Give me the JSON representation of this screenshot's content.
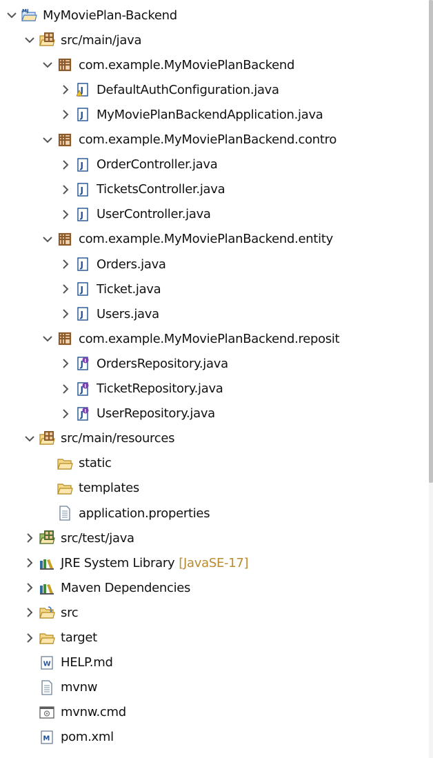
{
  "explorer": {
    "items": [
      {
        "label": "MyMoviePlan-Backend",
        "depth": 0,
        "state": "expanded",
        "icon": "maven-project-icon"
      },
      {
        "label": "src/main/java",
        "depth": 1,
        "state": "expanded",
        "icon": "source-folder-icon"
      },
      {
        "label": "com.example.MyMoviePlanBackend",
        "depth": 2,
        "state": "expanded",
        "icon": "package-icon"
      },
      {
        "label": "DefaultAuthConfiguration.java",
        "depth": 3,
        "state": "collapsed",
        "icon": "java-file-warning-icon"
      },
      {
        "label": "MyMoviePlanBackendApplication.java",
        "depth": 3,
        "state": "collapsed",
        "icon": "java-file-icon"
      },
      {
        "label": "com.example.MyMoviePlanBackend.contro",
        "depth": 2,
        "state": "expanded",
        "icon": "package-icon"
      },
      {
        "label": "OrderController.java",
        "depth": 3,
        "state": "collapsed",
        "icon": "java-file-icon"
      },
      {
        "label": "TicketsController.java",
        "depth": 3,
        "state": "collapsed",
        "icon": "java-file-icon"
      },
      {
        "label": "UserController.java",
        "depth": 3,
        "state": "collapsed",
        "icon": "java-file-icon"
      },
      {
        "label": "com.example.MyMoviePlanBackend.entity",
        "depth": 2,
        "state": "expanded",
        "icon": "package-icon"
      },
      {
        "label": "Orders.java",
        "depth": 3,
        "state": "collapsed",
        "icon": "java-file-icon"
      },
      {
        "label": "Ticket.java",
        "depth": 3,
        "state": "collapsed",
        "icon": "java-file-icon"
      },
      {
        "label": "Users.java",
        "depth": 3,
        "state": "collapsed",
        "icon": "java-file-icon"
      },
      {
        "label": "com.example.MyMoviePlanBackend.reposit",
        "depth": 2,
        "state": "expanded",
        "icon": "package-icon"
      },
      {
        "label": "OrdersRepository.java",
        "depth": 3,
        "state": "collapsed",
        "icon": "java-interface-icon"
      },
      {
        "label": "TicketRepository.java",
        "depth": 3,
        "state": "collapsed",
        "icon": "java-interface-icon"
      },
      {
        "label": "UserRepository.java",
        "depth": 3,
        "state": "collapsed",
        "icon": "java-interface-icon"
      },
      {
        "label": "src/main/resources",
        "depth": 1,
        "state": "expanded",
        "icon": "source-folder-icon"
      },
      {
        "label": "static",
        "depth": 2,
        "state": "leaf",
        "icon": "folder-icon"
      },
      {
        "label": "templates",
        "depth": 2,
        "state": "leaf",
        "icon": "folder-icon"
      },
      {
        "label": "application.properties",
        "depth": 2,
        "state": "leaf",
        "icon": "text-file-icon"
      },
      {
        "label": "src/test/java",
        "depth": 1,
        "state": "collapsed",
        "icon": "test-source-folder-icon"
      },
      {
        "label": "JRE System Library",
        "decoration": "[JavaSE-17]",
        "depth": 1,
        "state": "collapsed",
        "icon": "library-icon"
      },
      {
        "label": "Maven Dependencies",
        "depth": 1,
        "state": "collapsed",
        "icon": "library-icon"
      },
      {
        "label": "src",
        "depth": 1,
        "state": "collapsed",
        "icon": "src-folder-icon"
      },
      {
        "label": "target",
        "depth": 1,
        "state": "collapsed",
        "icon": "folder-icon"
      },
      {
        "label": "HELP.md",
        "depth": 1,
        "state": "leaf",
        "icon": "word-file-icon"
      },
      {
        "label": "mvnw",
        "depth": 1,
        "state": "leaf",
        "icon": "text-file-icon"
      },
      {
        "label": "mvnw.cmd",
        "depth": 1,
        "state": "leaf",
        "icon": "cmd-file-icon"
      },
      {
        "label": "pom.xml",
        "depth": 1,
        "state": "leaf",
        "icon": "maven-pom-icon"
      }
    ]
  },
  "colors": {
    "arrow": "#555555",
    "folder_fill": "#f5d78a",
    "folder_stroke": "#b58a22",
    "package_brown": "#8a5a2b",
    "java_blue": "#1d4f91",
    "decoration": "#b98a2e"
  }
}
